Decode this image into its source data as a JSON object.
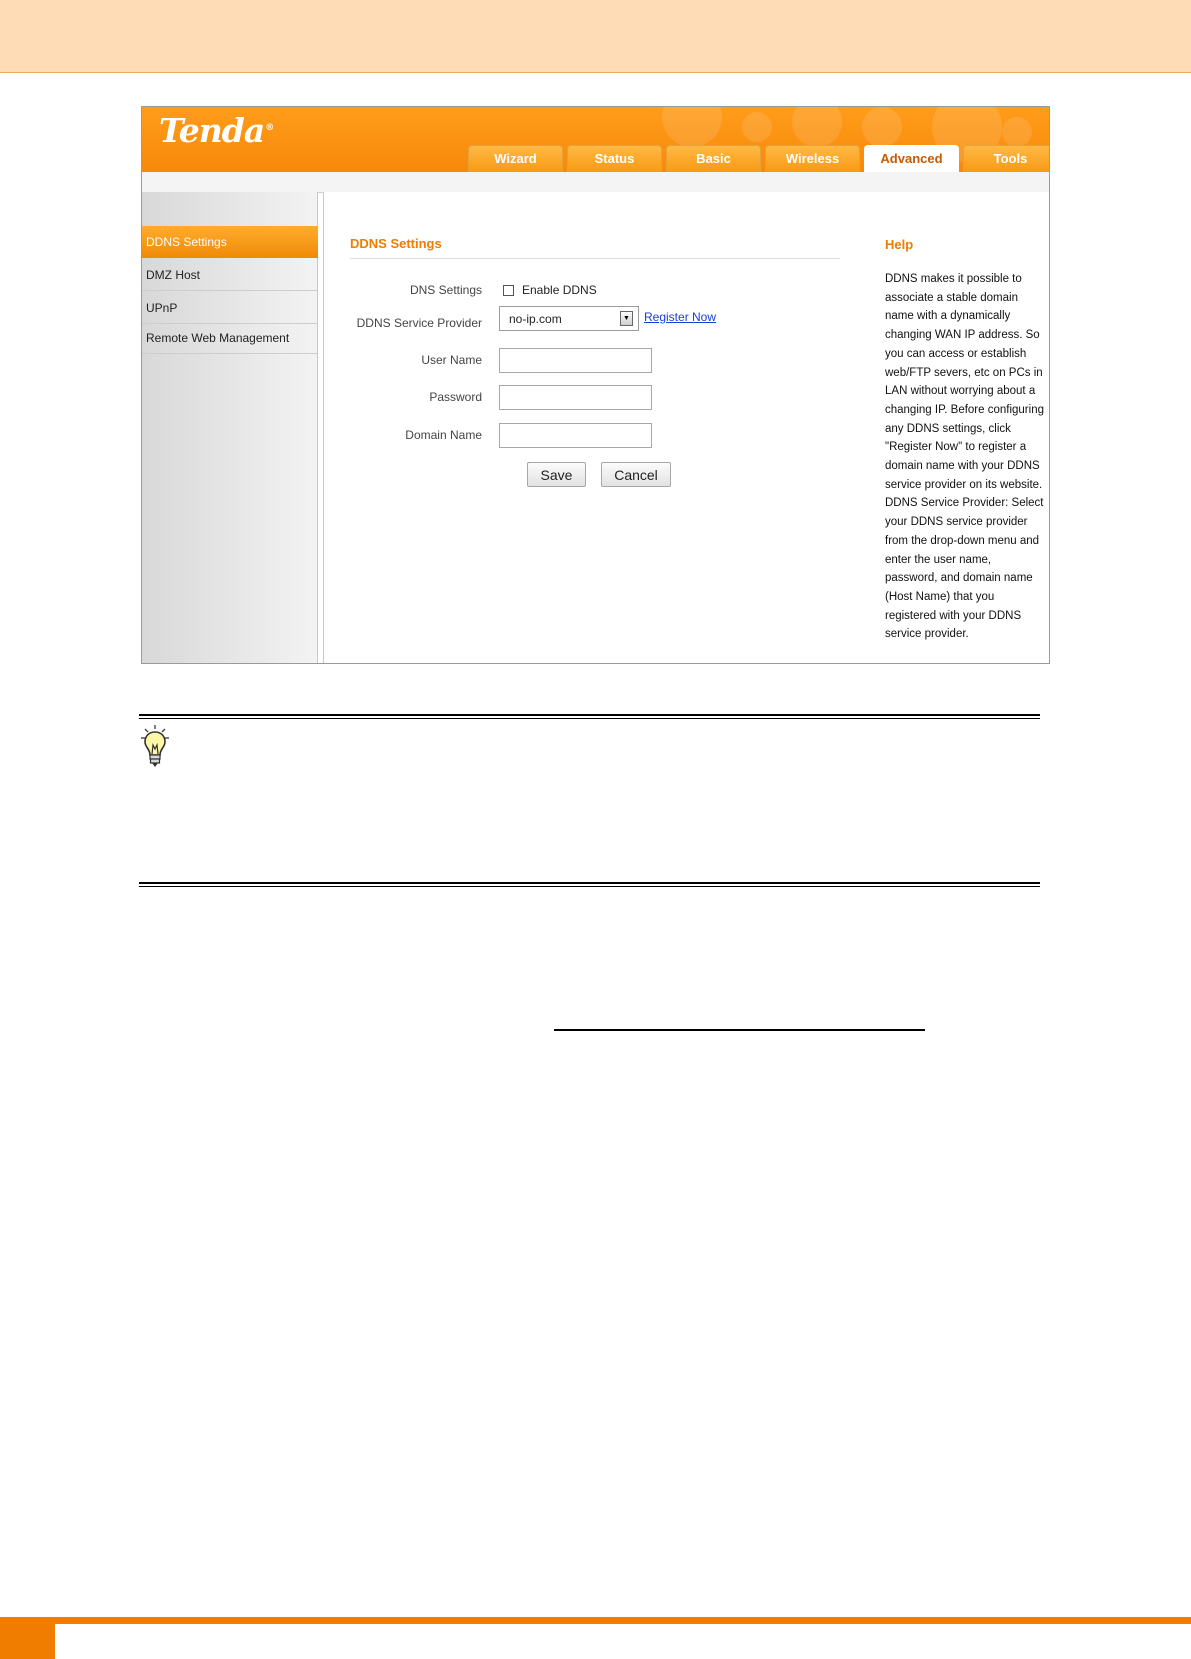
{
  "router": {
    "logo": "Tenda",
    "logo_mark": "®",
    "tabs": [
      {
        "label": "Wizard",
        "active": false
      },
      {
        "label": "Status",
        "active": false
      },
      {
        "label": "Basic",
        "active": false
      },
      {
        "label": "Wireless",
        "active": false
      },
      {
        "label": "Advanced",
        "active": true
      },
      {
        "label": "Tools",
        "active": false
      }
    ],
    "sidebar": {
      "items": [
        {
          "label": "DDNS Settings",
          "active": true
        },
        {
          "label": "DMZ Host",
          "active": false
        },
        {
          "label": "UPnP",
          "active": false
        },
        {
          "label": "Remote Web Management",
          "active": false
        }
      ]
    },
    "form": {
      "title": "DDNS Settings",
      "dns_settings_label": "DNS Settings",
      "enable_ddns_label": "Enable DDNS",
      "enable_ddns_checked": false,
      "provider_label": "DDNS Service Provider",
      "provider_value": "no-ip.com",
      "register_link": "Register Now",
      "username_label": "User Name",
      "username_value": "",
      "password_label": "Password",
      "password_value": "",
      "domain_label": "Domain Name",
      "domain_value": "",
      "save_label": "Save",
      "cancel_label": "Cancel"
    },
    "help": {
      "title": "Help",
      "text": "DDNS makes it possible to associate a stable domain name with a dynamically changing WAN IP address. So you can access or establish web/FTP severs, etc on PCs in LAN without worrying about a changing IP. Before configuring any DDNS settings, click \"Register Now\" to register a domain name with your DDNS service provider on its website. DDNS Service Provider: Select your DDNS service provider from the drop-down menu and enter the user name, password, and domain name (Host Name) that you registered with your DDNS service provider."
    }
  },
  "colors": {
    "accent": "#f07c00",
    "header_band": "#fddcb6",
    "link": "#1a3fd6"
  },
  "icons": {
    "note": "lightbulb-icon"
  }
}
